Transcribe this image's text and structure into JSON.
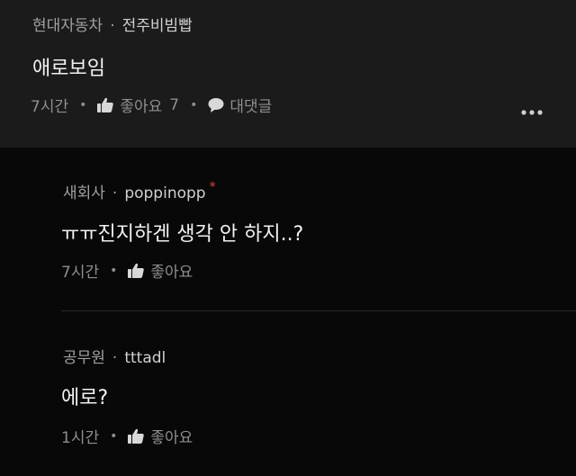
{
  "comments": [
    {
      "company": "현대자동차",
      "author": "전주비빔빱",
      "text": "애로보임",
      "time": "7시간",
      "like_label": "좋아요",
      "like_count": "7",
      "reply_label": "대댓글"
    },
    {
      "company": "새회사",
      "author": "poppinopp",
      "author_badge": "*",
      "text": "ㅠㅠ진지하겐 생각 안 하지..?",
      "time": "7시간",
      "like_label": "좋아요"
    },
    {
      "company": "공무원",
      "author": "tttadl",
      "text": "에로?",
      "time": "1시간",
      "like_label": "좋아요"
    }
  ],
  "colors": {
    "background": "#080808",
    "top_comment_bg": "#1b1b1b",
    "badge": "#e0443e",
    "text": "#f2f2f2",
    "muted": "#8e8e8e"
  },
  "icons": {
    "like": "thumbs-up-icon",
    "reply": "speech-bubble-icon",
    "more": "more-dots-icon"
  }
}
